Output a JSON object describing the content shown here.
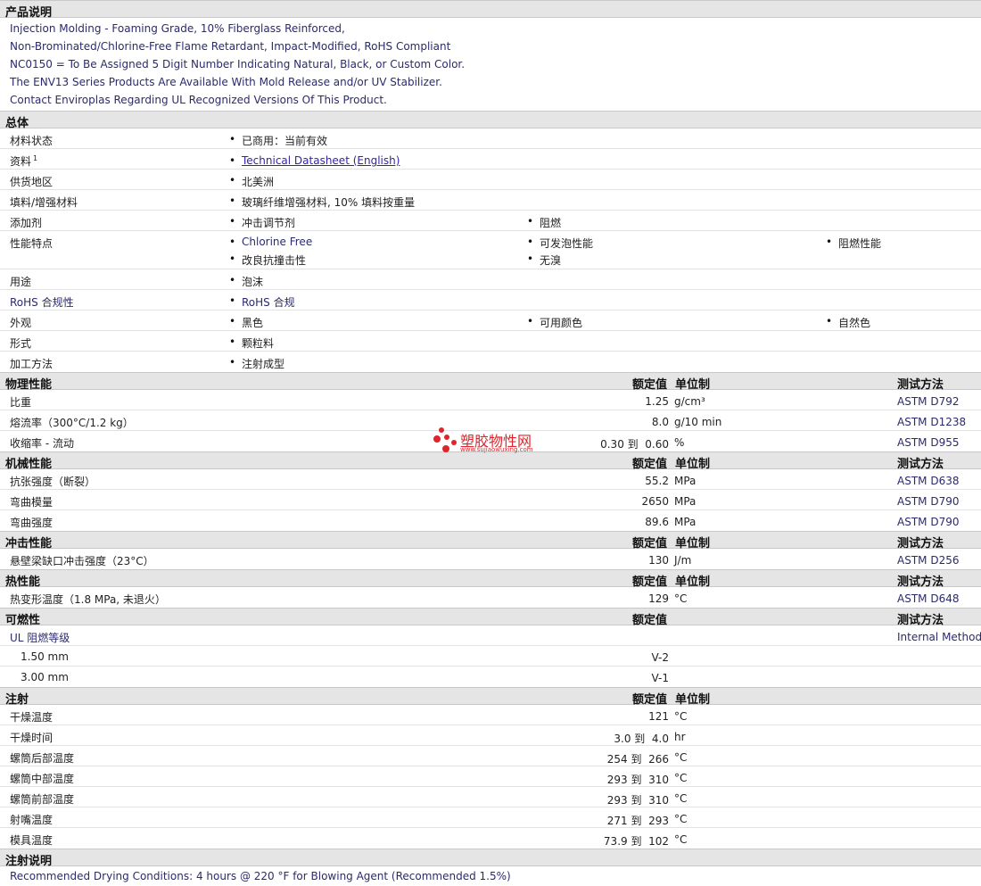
{
  "description": {
    "title": "产品说明",
    "lines": [
      "Injection Molding - Foaming Grade, 10% Fiberglass Reinforced,",
      "Non-Brominated/Chlorine-Free Flame Retardant, Impact-Modified, RoHS Compliant",
      "NC0150 = To Be Assigned 5 Digit Number Indicating Natural, Black, or Custom Color.",
      "The ENV13 Series Products Are Available With Mold Release and/or UV Stabilizer.",
      "Contact Enviroplas Regarding UL Recognized Versions Of This Product."
    ]
  },
  "general": {
    "title": "总体",
    "material_status": {
      "label": "材料状态",
      "value": "已商用：当前有效"
    },
    "literature": {
      "label": "资料",
      "sup": "1",
      "link": "Technical Datasheet (English)"
    },
    "availability": {
      "label": "供货地区",
      "value": "北美洲"
    },
    "filler": {
      "label": "填料/增强材料",
      "value": "玻璃纤维增强材料, 10% 填料按重量"
    },
    "additives": {
      "label": "添加剂",
      "values": [
        "冲击调节剂",
        "阻燃"
      ]
    },
    "features": {
      "label": "性能特点",
      "values": [
        "Chlorine Free",
        "可发泡性能",
        "阻燃性能",
        "改良抗撞击性",
        "无溴"
      ]
    },
    "uses": {
      "label": "用途",
      "value": "泡沫"
    },
    "rohs": {
      "label": "RoHS 合规性",
      "value": "RoHS 合规"
    },
    "appearance": {
      "label": "外观",
      "values": [
        "黑色",
        "可用颜色",
        "自然色"
      ]
    },
    "form": {
      "label": "形式",
      "value": "颗粒料"
    },
    "processing": {
      "label": "加工方法",
      "value": "注射成型"
    }
  },
  "headers": {
    "nominal": "额定值",
    "unit": "单位制",
    "test": "测试方法"
  },
  "physical": {
    "title": "物理性能",
    "rows": [
      {
        "label": "比重",
        "nominal": "1.25",
        "unit": "g/cm³",
        "test": "ASTM D792"
      },
      {
        "label": "熔流率（300°C/1.2 kg）",
        "nominal": "8.0",
        "unit": "g/10 min",
        "test": "ASTM D1238"
      },
      {
        "label": "收缩率 - 流动",
        "nominal": "0.30 到  0.60",
        "unit": "%",
        "test": "ASTM D955"
      }
    ]
  },
  "mechanical": {
    "title": "机械性能",
    "rows": [
      {
        "label": "抗张强度（断裂）",
        "nominal": "55.2",
        "unit": "MPa",
        "test": "ASTM D638"
      },
      {
        "label": "弯曲模量",
        "nominal": "2650",
        "unit": "MPa",
        "test": "ASTM D790"
      },
      {
        "label": "弯曲强度",
        "nominal": "89.6",
        "unit": "MPa",
        "test": "ASTM D790"
      }
    ]
  },
  "impact": {
    "title": "冲击性能",
    "rows": [
      {
        "label": "悬壁梁缺口冲击强度（23°C）",
        "nominal": "130",
        "unit": "J/m",
        "test": "ASTM D256"
      }
    ]
  },
  "thermal": {
    "title": "热性能",
    "rows": [
      {
        "label": "热变形温度（1.8 MPa, 未退火）",
        "nominal": "129",
        "unit": "°C",
        "test": "ASTM D648"
      }
    ]
  },
  "flammability": {
    "title": "可燃性",
    "ul_label": "UL 阻燃等级",
    "ul_test": "Internal Method",
    "rows": [
      {
        "label": "1.50 mm",
        "nominal": "V-2"
      },
      {
        "label": "3.00 mm",
        "nominal": "V-1"
      }
    ]
  },
  "injection": {
    "title": "注射",
    "rows": [
      {
        "label": "干燥温度",
        "nominal": "121",
        "unit": "°C"
      },
      {
        "label": "干燥时间",
        "nominal": "3.0 到  4.0",
        "unit": "hr"
      },
      {
        "label": "螺筒后部温度",
        "nominal": "254 到  266",
        "unit": "°C"
      },
      {
        "label": "螺筒中部温度",
        "nominal": "293 到  310",
        "unit": "°C"
      },
      {
        "label": "螺筒前部温度",
        "nominal": "293 到  310",
        "unit": "°C"
      },
      {
        "label": "射嘴温度",
        "nominal": "271 到  293",
        "unit": "°C"
      },
      {
        "label": "模具温度",
        "nominal": "73.9 到  102",
        "unit": "°C"
      }
    ]
  },
  "injection_notes": {
    "title": "注射说明",
    "text": "Recommended Drying Conditions: 4 hours @ 220 °F for Blowing Agent (Recommended 1.5%)"
  },
  "watermark": {
    "text": "塑胶物性网",
    "url": "www.sujiaowuxing.com",
    "color": "#e0242c"
  }
}
